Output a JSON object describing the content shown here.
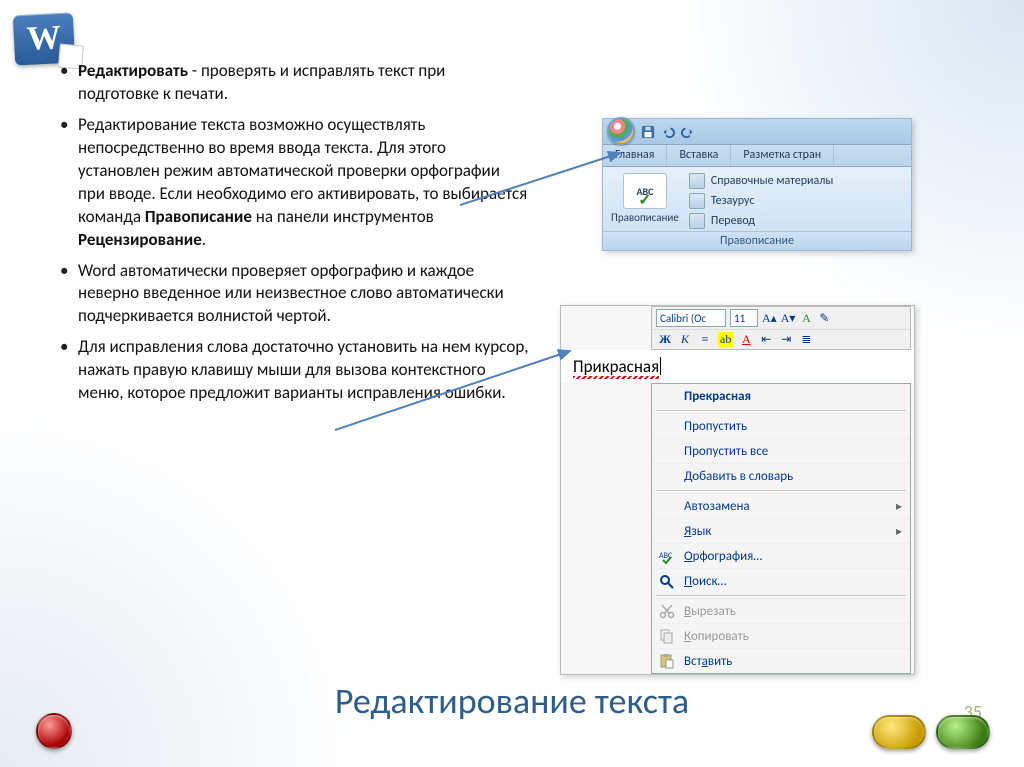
{
  "logo_letter": "W",
  "bullets": {
    "b1_bold": "Редактировать",
    "b1_rest": " - проверять и исправлять текст при подготовке к печати.",
    "b2_a": "Редактирование текста возможно  осуществлять непосредственно во время ввода текста. Для этого установлен режим автоматической проверки орфографии при вводе. Если необходимо его активировать, то выбирается команда ",
    "b2_bold1": "Правописание",
    "b2_b": " на панели инструментов ",
    "b2_bold2": "Рецензирование",
    "b2_c": ".",
    "b3": "Word автоматически проверяет орфографию и каждое неверно введенное или неизвестное слово автоматически подчеркивается волнистой чертой.",
    "b4": "Для исправления слова достаточно установить на нем курсор, нажать правую клавишу мыши для вызова контекстного меню, которое предложит варианты исправления ошибки."
  },
  "ribbon": {
    "tabs": [
      "Главная",
      "Вставка",
      "Разметка стран"
    ],
    "big_button_top": "ABC",
    "big_button_label": "Правописание",
    "cmd1": "Справочные материалы",
    "cmd2": "Тезаурус",
    "cmd3": "Перевод",
    "group_caption": "Правописание"
  },
  "doc": {
    "font_name": "Calibri (Ос",
    "font_size": "11",
    "misspelled": "Прикрасная"
  },
  "context_menu": {
    "suggestion": "Прекрасная",
    "skip": "Пропустить",
    "skip_all": "Пропустить все",
    "add_dict_u": "Д",
    "add_dict_rest": "обавить в словарь",
    "autocorrect": "Автозамена",
    "lang_u": "Я",
    "lang_rest": "зык",
    "spelling_u": "О",
    "spelling_rest": "рфография…",
    "search_u": "П",
    "search_rest": "оиск…",
    "cut_u": "В",
    "cut_rest": "ырезать",
    "copy_u": "К",
    "copy_rest": "опировать",
    "paste": "Вст",
    "paste_u": "а",
    "paste_rest": "вить"
  },
  "slide_title": "Редактирование текста",
  "page_number": "35"
}
